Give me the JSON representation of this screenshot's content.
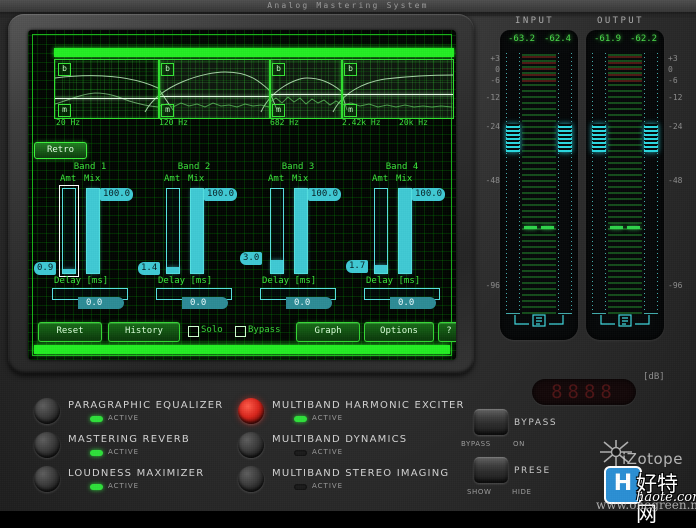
{
  "window": {
    "title": "Analog Mastering System"
  },
  "display": {
    "retro_button": "Retro",
    "crossover_labels": [
      "20 Hz",
      "120 Hz",
      "682 Hz",
      "2.42k Hz",
      "20k Hz"
    ],
    "band_toggle_bypass": "b",
    "band_toggle_mute": "m",
    "bands": [
      {
        "title": "Band 1",
        "amt_label": "Amt",
        "mix_label": "Mix",
        "amt_value": "0.9",
        "amt_pct": 5,
        "mix_value": "100.0",
        "mix_pct": 100,
        "delay_label": "Delay [ms]",
        "delay_value": "0.0",
        "selected": true
      },
      {
        "title": "Band 2",
        "amt_label": "Amt",
        "mix_label": "Mix",
        "amt_value": "1.4",
        "amt_pct": 7,
        "mix_value": "100.0",
        "mix_pct": 100,
        "delay_label": "Delay [ms]",
        "delay_value": "0.0",
        "selected": false
      },
      {
        "title": "Band 3",
        "amt_label": "Amt",
        "mix_label": "Mix",
        "amt_value": "3.0",
        "amt_pct": 15,
        "mix_value": "100.0",
        "mix_pct": 100,
        "delay_label": "Delay [ms]",
        "delay_value": "0.0",
        "selected": false
      },
      {
        "title": "Band 4",
        "amt_label": "Amt",
        "mix_label": "Mix",
        "amt_value": "1.7",
        "amt_pct": 9,
        "mix_value": "100.0",
        "mix_pct": 100,
        "delay_label": "Delay [ms]",
        "delay_value": "0.0",
        "selected": false
      }
    ],
    "buttons": {
      "reset": "Reset",
      "history": "History",
      "solo": "Solo",
      "bypass": "Bypass",
      "graph": "Graph",
      "options": "Options",
      "help": "?"
    }
  },
  "meters": {
    "input": {
      "label": "INPUT",
      "left_value": "-63.2",
      "right_value": "-62.4"
    },
    "output": {
      "label": "OUTPUT",
      "left_value": "-61.9",
      "right_value": "-62.2"
    },
    "scale": [
      "+3",
      "0",
      "-6",
      "-12",
      "-24",
      "-48",
      "-96"
    ],
    "link_icon": "meter-link-icon"
  },
  "readout": {
    "digits": "8888",
    "unit": "[dB]"
  },
  "modules": {
    "active_label": "ACTIVE",
    "left_column": [
      {
        "name": "PARAGRAPHIC EQUALIZER",
        "active": true,
        "selected": false
      },
      {
        "name": "MASTERING REVERB",
        "active": true,
        "selected": false
      },
      {
        "name": "LOUDNESS MAXIMIZER",
        "active": true,
        "selected": false
      }
    ],
    "right_column": [
      {
        "name": "MULTIBAND HARMONIC EXCITER",
        "active": true,
        "selected": true
      },
      {
        "name": "MULTIBAND DYNAMICS",
        "active": false,
        "selected": false
      },
      {
        "name": "MULTIBAND STEREO IMAGING",
        "active": false,
        "selected": false
      }
    ]
  },
  "switches": [
    {
      "title": "BYPASS",
      "left_option": "BYPASS",
      "right_option": "ON"
    },
    {
      "title": "PRESE",
      "left_option": "SHOW",
      "right_option": "HIDE"
    }
  ],
  "branding": {
    "logo": "iZotope",
    "watermark_letter": "H",
    "watermark_cn": "好特网",
    "watermark_url": "haote.com",
    "watermark_alt": "www.onegreen.net"
  }
}
